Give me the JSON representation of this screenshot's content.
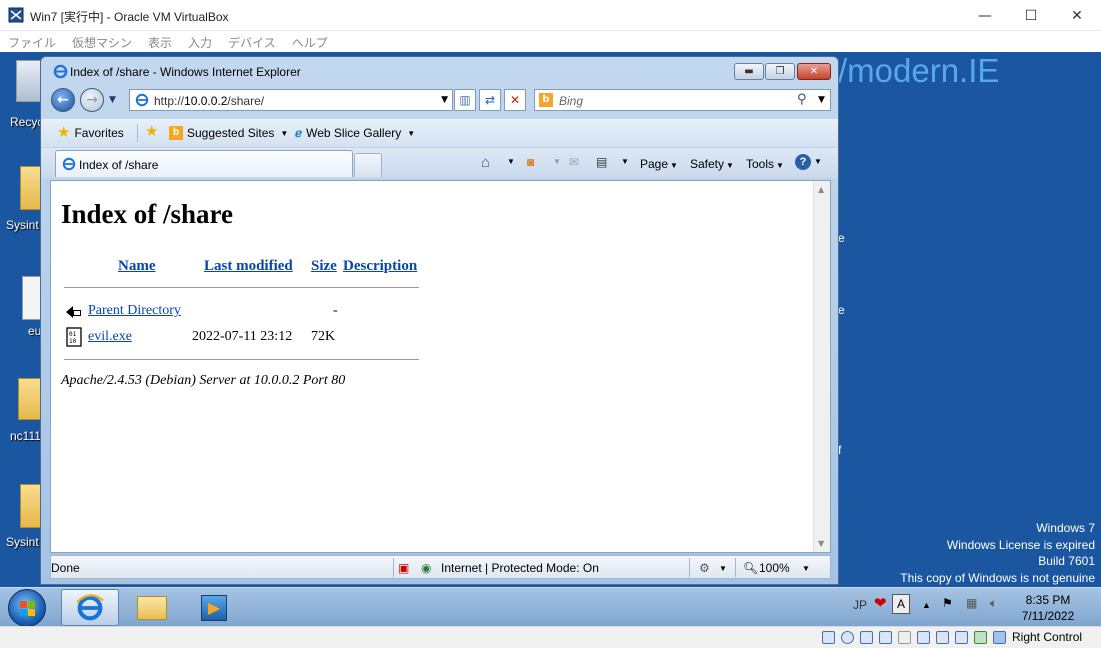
{
  "vbox": {
    "title": "Win7 [実行中] - Oracle VM VirtualBox",
    "menu": [
      "ファイル",
      "仮想マシン",
      "表示",
      "入力",
      "デバイス",
      "ヘルプ"
    ],
    "host_key": "Right Control"
  },
  "desktop": {
    "icons": [
      {
        "label": "Recyc"
      },
      {
        "label": "Sysint"
      },
      {
        "label": "eu"
      },
      {
        "label": "nc111"
      },
      {
        "label": "Sysint"
      }
    ],
    "brand": "/modern.IE",
    "edge_fragments": [
      "e",
      "e",
      "f"
    ],
    "license": [
      "Windows 7",
      "Windows License is expired",
      "Build 7601",
      "This copy of Windows is not genuine"
    ]
  },
  "ie": {
    "title": "Index of /share - Windows Internet Explorer",
    "address_prefix": "http://",
    "address_host": "10.0.0.2",
    "address_path": "/share/",
    "search_placeholder": "Bing",
    "favorites_label": "Favorites",
    "suggested_sites_label": "Suggested Sites",
    "web_slice_label": "Web Slice Gallery",
    "tab_label": "Index of /share",
    "commands": {
      "page": "Page",
      "safety": "Safety",
      "tools": "Tools"
    },
    "status": {
      "done": "Done",
      "zone": "Internet | Protected Mode: On",
      "zoom": "100%"
    }
  },
  "page": {
    "heading": "Index of /share",
    "columns": {
      "name": "Name",
      "last_modified": "Last modified",
      "size": "Size",
      "description": "Description"
    },
    "rows": [
      {
        "name": "Parent Directory",
        "modified": "",
        "size": "-",
        "icon": "back-icon"
      },
      {
        "name": "evil.exe",
        "modified": "2022-07-11 23:12",
        "size": "72K",
        "icon": "binary-file-icon"
      }
    ],
    "server_signature": "Apache/2.4.53 (Debian) Server at 10.0.0.2 Port 80"
  },
  "taskbar": {
    "ime": "JP",
    "ime_mode": "A",
    "time": "8:35 PM",
    "date": "7/11/2022"
  },
  "colors": {
    "desktop": "#1b57a0",
    "link": "#0645ad",
    "brand": "#58a7ee"
  }
}
